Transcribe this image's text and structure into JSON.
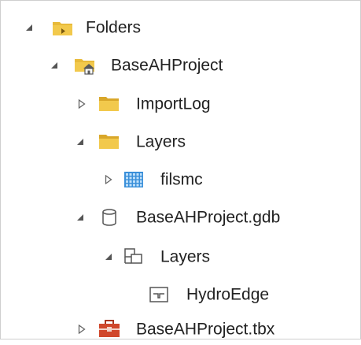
{
  "tree": {
    "items": [
      {
        "label": "Folders",
        "icon": "folders-icon",
        "state": "expanded"
      },
      {
        "label": "BaseAHProject",
        "icon": "home-folder-icon",
        "state": "expanded"
      },
      {
        "label": "ImportLog",
        "icon": "folder-icon",
        "state": "collapsed"
      },
      {
        "label": "Layers",
        "icon": "folder-icon",
        "state": "expanded"
      },
      {
        "label": "filsmc",
        "icon": "raster-icon",
        "state": "collapsed"
      },
      {
        "label": "BaseAHProject.gdb",
        "icon": "geodatabase-icon",
        "state": "expanded"
      },
      {
        "label": "Layers",
        "icon": "feature-dataset-icon",
        "state": "expanded"
      },
      {
        "label": "HydroEdge",
        "icon": "line-feature-class-icon",
        "state": "leaf"
      },
      {
        "label": "BaseAHProject.tbx",
        "icon": "toolbox-icon",
        "state": "collapsed"
      }
    ]
  },
  "colors": {
    "folder_yellow": "#E8BA3A",
    "folder_dark": "#C99A20",
    "toolbox_red": "#D0472B",
    "raster_blue": "#3A8FD9",
    "text": "#222222",
    "toggle": "#555555"
  }
}
